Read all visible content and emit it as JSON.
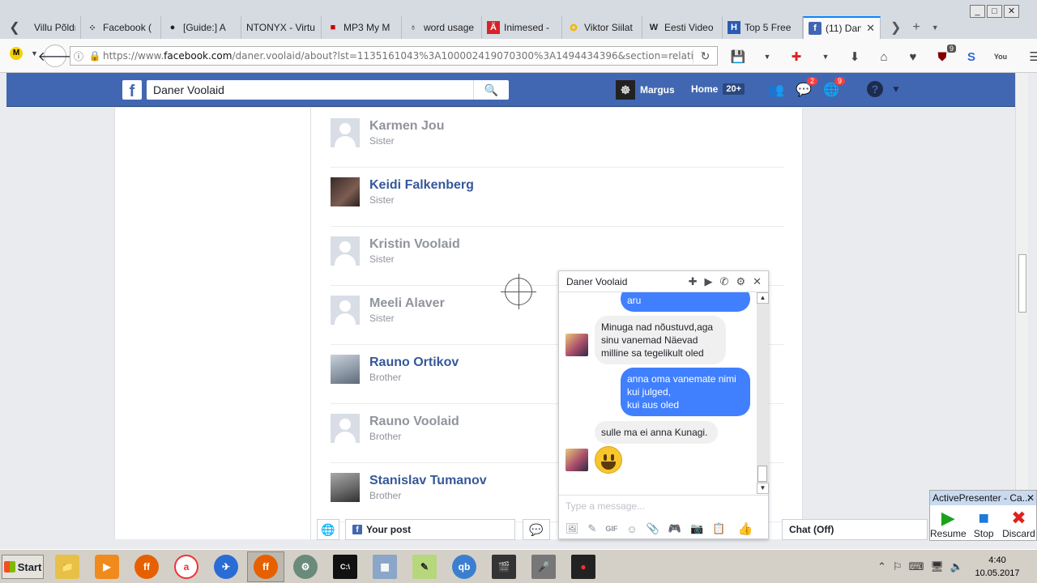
{
  "browser": {
    "tabs": [
      {
        "label": "Villu Põldm",
        "icon": "person-favicon",
        "icon_glyph": ""
      },
      {
        "label": "Facebook (",
        "icon": "dots-favicon",
        "icon_glyph": "⁘"
      },
      {
        "label": "[Guide:] A",
        "icon": "obs-favicon",
        "icon_glyph": "●"
      },
      {
        "label": "NTONYX - Virtu",
        "icon": "none",
        "icon_glyph": ""
      },
      {
        "label": "MP3 My M",
        "icon": "record-favicon",
        "icon_glyph": "■"
      },
      {
        "label": "word usage",
        "icon": "link-favicon",
        "icon_glyph": "♁"
      },
      {
        "label": "Inimesed -",
        "icon": "a-favicon",
        "icon_glyph": "Ä"
      },
      {
        "label": "Viktor Siilat",
        "icon": "star-favicon",
        "icon_glyph": "✪"
      },
      {
        "label": "Eesti Video",
        "icon": "wikipedia-favicon",
        "icon_glyph": "W"
      },
      {
        "label": "Top 5 Free",
        "icon": "h-favicon",
        "icon_glyph": "H"
      },
      {
        "label": "(11) Dan",
        "icon": "facebook-favicon",
        "icon_glyph": "f",
        "active": true
      }
    ],
    "url_prefix": "https://www.",
    "url_host": "facebook.com",
    "url_rest": "/daner.voolaid/about?lst=1135161043%3A100002419070300%3A1494434396&section=relationship&pnre",
    "toolbar_badges": {
      "ublock": "9"
    }
  },
  "facebook": {
    "search_value": "Daner Voolaid",
    "user_name": "Margus",
    "home_label": "Home",
    "home_count": "20+",
    "messages_badge": "2",
    "notifications_badge": "9"
  },
  "family_members": [
    {
      "name": "Karmen Jou",
      "relation": "Sister",
      "linked": false,
      "avatar": "placeholder"
    },
    {
      "name": "Keidi Falkenberg",
      "relation": "Sister",
      "linked": true,
      "avatar": "photo"
    },
    {
      "name": "Kristin Voolaid",
      "relation": "Sister",
      "linked": false,
      "avatar": "placeholder"
    },
    {
      "name": "Meeli Alaver",
      "relation": "Sister",
      "linked": false,
      "avatar": "placeholder"
    },
    {
      "name": "Rauno Ortikov",
      "relation": "Brother",
      "linked": true,
      "avatar": "photo2"
    },
    {
      "name": "Rauno Voolaid",
      "relation": "Brother",
      "linked": false,
      "avatar": "placeholder"
    },
    {
      "name": "Stanislav Tumanov",
      "relation": "Brother",
      "linked": true,
      "avatar": "photo3"
    }
  ],
  "chat": {
    "title": "Daner Voolaid",
    "messages": [
      {
        "from": "me",
        "text": "aru"
      },
      {
        "from": "them",
        "text": "Minuga nad nõustuvd,aga\nsinu vanemad Näevad\nmilline sa tegelikult oled"
      },
      {
        "from": "me",
        "text": "anna oma vanemate nimi\nkui julged,\nkui aus oled"
      },
      {
        "from": "them",
        "text": "sulle ma ei anna Kunagi."
      },
      {
        "from": "them",
        "text": "😀",
        "emoji": "grinning-face"
      }
    ],
    "input_placeholder": "Type a message..."
  },
  "bottom_bar": {
    "your_post": "Your post",
    "chat_status": "Chat (Off)"
  },
  "activepresenter": {
    "title": "ActivePresenter - Ca...",
    "buttons": [
      "Resume",
      "Stop",
      "Discard"
    ]
  },
  "taskbar": {
    "start_label": "Start",
    "time": "4:40",
    "date": "10.05.2017"
  },
  "colors": {
    "fb_blue": "#4267b2",
    "link": "#365899",
    "chat_bubble_me": "#4080ff"
  }
}
